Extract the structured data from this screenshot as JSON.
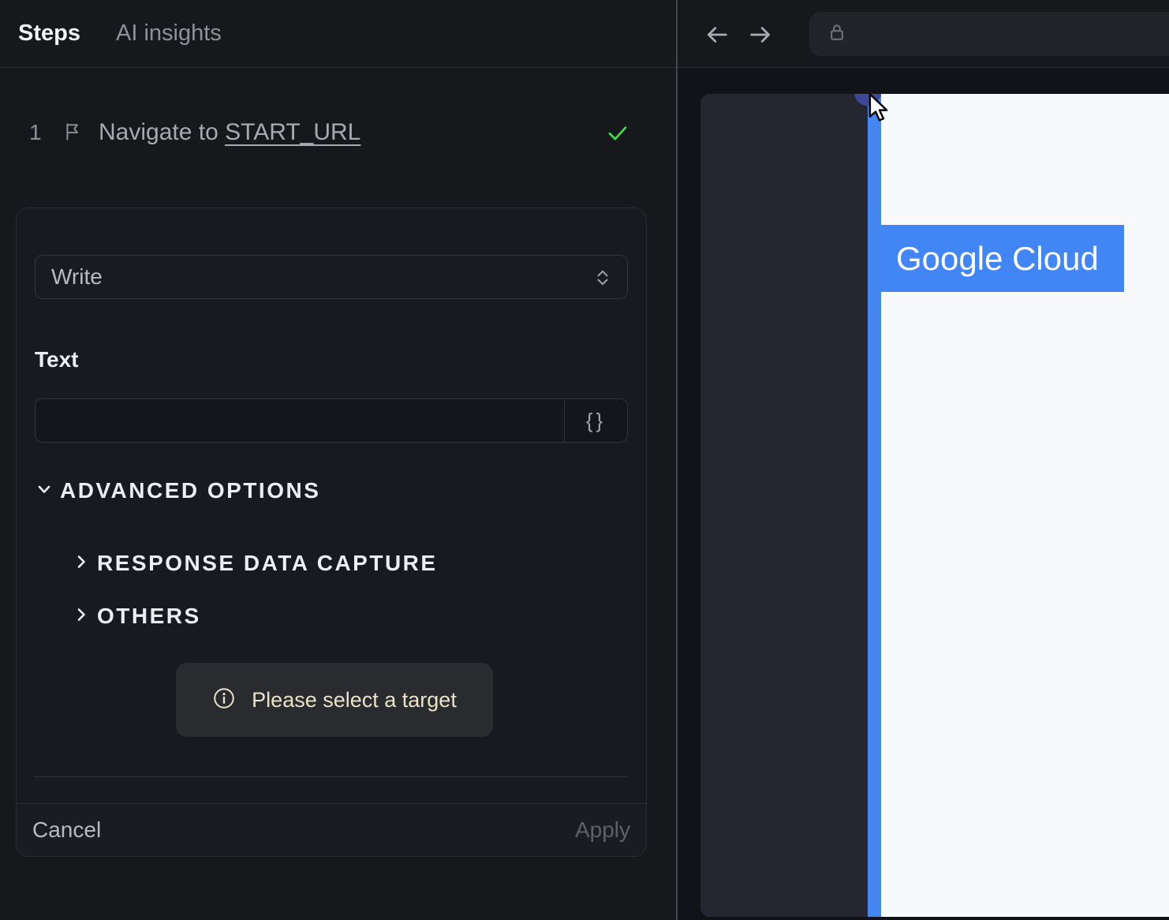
{
  "colors": {
    "accent_blue": "#4285f4",
    "success_green": "#3fdd4e",
    "hint_cream": "#ebe2c8",
    "panel_dark": "#17181c",
    "preview_sidebar_navy": "#252631",
    "marker_indigo": "#3e4897",
    "page_white": "#f8f9fa"
  },
  "icons": {
    "step": "flag-icon",
    "step_status": "check-icon",
    "select": "chevrons-up-down-icon",
    "variable": "curly-braces",
    "advanced": "chevron-down-icon",
    "subsection": "chevron-right-icon",
    "hint": "info-circle-icon",
    "nav": [
      "arrow-left-icon",
      "arrow-right-icon"
    ],
    "address": "lock-icon",
    "pointer": "cursor-arrow-icon"
  },
  "left_panel": {
    "tabs": [
      {
        "label": "Steps",
        "active": true
      },
      {
        "label": "AI insights",
        "active": false
      }
    ],
    "step": {
      "number": "1",
      "action_prefix": "Navigate to ",
      "action_link": "START_URL",
      "status": "success"
    },
    "editor": {
      "command_select": {
        "value": "Write"
      },
      "text_field": {
        "label": "Text",
        "value": "",
        "placeholder": ""
      },
      "variable_button_label": "{}",
      "advanced_options_label": "ADVANCED OPTIONS",
      "subsections": [
        {
          "label": "RESPONSE DATA CAPTURE"
        },
        {
          "label": "OTHERS"
        }
      ],
      "target_hint": "Please select a target",
      "footer": {
        "cancel_label": "Cancel",
        "apply_label": "Apply"
      }
    }
  },
  "browser": {
    "toolbar": {
      "url_value": ""
    },
    "page": {
      "brand_label": "Google Cloud"
    }
  }
}
